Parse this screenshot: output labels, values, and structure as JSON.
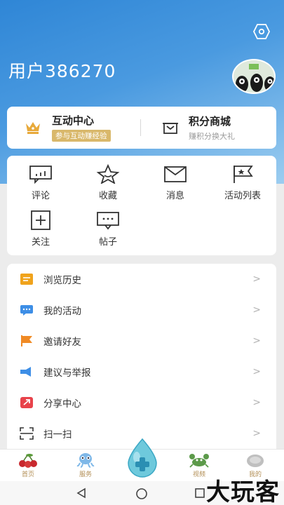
{
  "user": {
    "name": "用户386270"
  },
  "top_cards": {
    "interaction": {
      "title": "互动中心",
      "subtitle": "参与互动赚经验"
    },
    "points_mall": {
      "title": "积分商城",
      "subtitle": "赚积分换大礼"
    }
  },
  "grid": [
    {
      "label": "评论",
      "icon": "comment-icon"
    },
    {
      "label": "收藏",
      "icon": "star-icon"
    },
    {
      "label": "消息",
      "icon": "mail-icon"
    },
    {
      "label": "活动列表",
      "icon": "flag-icon"
    },
    {
      "label": "关注",
      "icon": "plus-square-icon"
    },
    {
      "label": "帖子",
      "icon": "post-icon"
    }
  ],
  "list": [
    {
      "label": "浏览历史",
      "icon": "history-icon",
      "color": "#f0a31c"
    },
    {
      "label": "我的活动",
      "icon": "chat-icon",
      "color": "#3d8ee6"
    },
    {
      "label": "邀请好友",
      "icon": "flag-icon",
      "color": "#f08a24"
    },
    {
      "label": "建议与举报",
      "icon": "megaphone-icon",
      "color": "#3d8ee6"
    },
    {
      "label": "分享中心",
      "icon": "share-icon",
      "color": "#e8434b"
    },
    {
      "label": "扫一扫",
      "icon": "scan-icon",
      "color": "#333333"
    }
  ],
  "chevron": ">",
  "tabs": [
    {
      "label": "首页",
      "icon": "cherry-icon"
    },
    {
      "label": "服务",
      "icon": "octopus-icon"
    },
    {
      "label": "",
      "icon": "water-drop-plus-icon"
    },
    {
      "label": "视频",
      "icon": "crab-icon"
    },
    {
      "label": "我的",
      "icon": "shell-icon"
    }
  ],
  "watermark": "大玩客",
  "colors": {
    "header_start": "#2f86d6",
    "header_end": "#9ccdf0",
    "badge_gold": "#d9b86b",
    "tab_label": "#b38f56"
  }
}
